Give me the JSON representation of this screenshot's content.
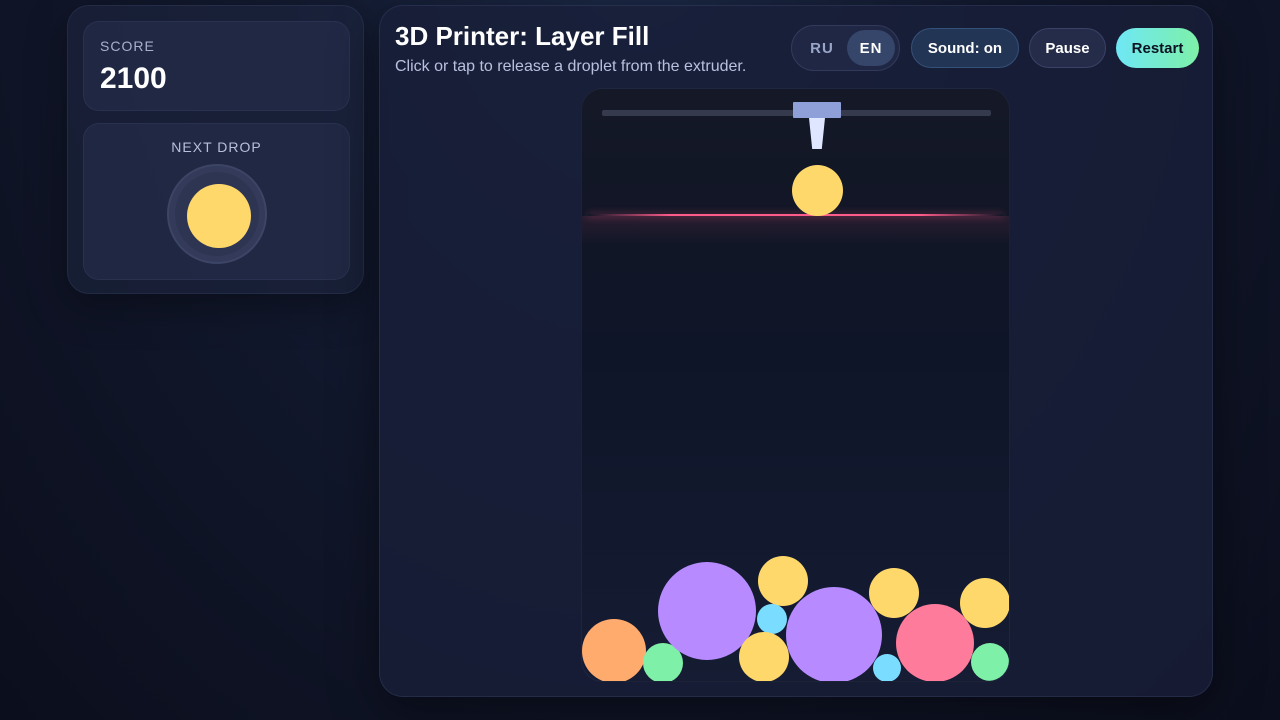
{
  "score": {
    "label": "SCORE",
    "value": "2100"
  },
  "next_drop": {
    "label": "NEXT DROP",
    "color": "#ffd86b"
  },
  "header": {
    "title": "3D Printer: Layer Fill",
    "subtitle": "Click or tap to release a droplet from the extruder."
  },
  "language": {
    "options": [
      "RU",
      "EN"
    ],
    "selected": "EN"
  },
  "controls": {
    "sound_label": "Sound: on",
    "pause_label": "Pause",
    "restart_label": "Restart"
  },
  "colors": {
    "yellow": "#ffd86b",
    "purple": "#b78bff",
    "orange": "#ffab6e",
    "green": "#7ef0a8",
    "cyan": "#7adcff",
    "pink": "#ff7b9c",
    "accent_gradient_start": "#6ee7f5",
    "accent_gradient_end": "#7ef0a8",
    "danger_line": "#ff5c8a"
  },
  "held_droplet": {
    "color": "yellow"
  },
  "droplets": [
    {
      "color": "orange"
    },
    {
      "color": "green"
    },
    {
      "color": "purple"
    },
    {
      "color": "yellow"
    },
    {
      "color": "cyan"
    },
    {
      "color": "yellow"
    },
    {
      "color": "purple"
    },
    {
      "color": "cyan"
    },
    {
      "color": "yellow"
    },
    {
      "color": "pink"
    },
    {
      "color": "yellow"
    },
    {
      "color": "green"
    }
  ]
}
